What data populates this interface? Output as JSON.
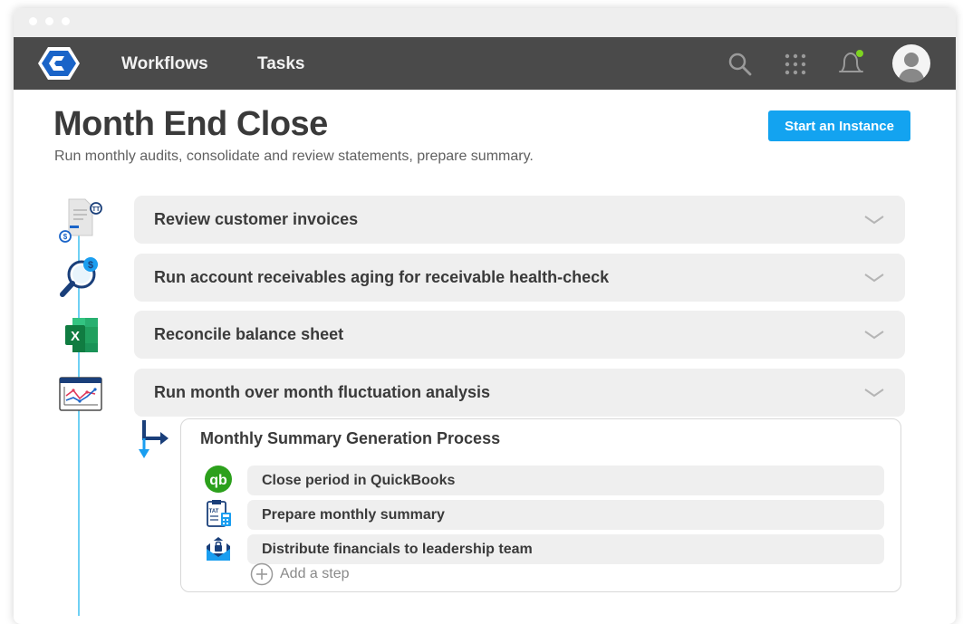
{
  "nav": {
    "links": [
      "Workflows",
      "Tasks"
    ]
  },
  "page": {
    "title": "Month End Close",
    "subtitle": "Run monthly audits, consolidate and review statements, prepare summary.",
    "start_button": "Start an Instance"
  },
  "steps": [
    {
      "label": "Review customer invoices",
      "icon": "invoice-document-icon"
    },
    {
      "label": "Run account receivables aging for receivable health-check",
      "icon": "magnifier-dollar-icon"
    },
    {
      "label": "Reconcile balance sheet",
      "icon": "excel-icon"
    },
    {
      "label": "Run month over month fluctuation analysis",
      "icon": "chart-window-icon"
    }
  ],
  "subprocess": {
    "title": "Monthly Summary Generation Process",
    "steps": [
      {
        "label": "Close period in QuickBooks",
        "icon": "quickbooks-icon"
      },
      {
        "label": "Prepare monthly summary",
        "icon": "clipboard-report-icon"
      },
      {
        "label": "Distribute financials to leadership team",
        "icon": "secure-mail-icon"
      }
    ],
    "add_step": "Add a step"
  },
  "colors": {
    "accent": "#13a3f0",
    "topbar": "#4a4a4a",
    "row_bg": "#efefef",
    "timeline": "#6fd0f4",
    "notification_dot": "#7ed321"
  }
}
